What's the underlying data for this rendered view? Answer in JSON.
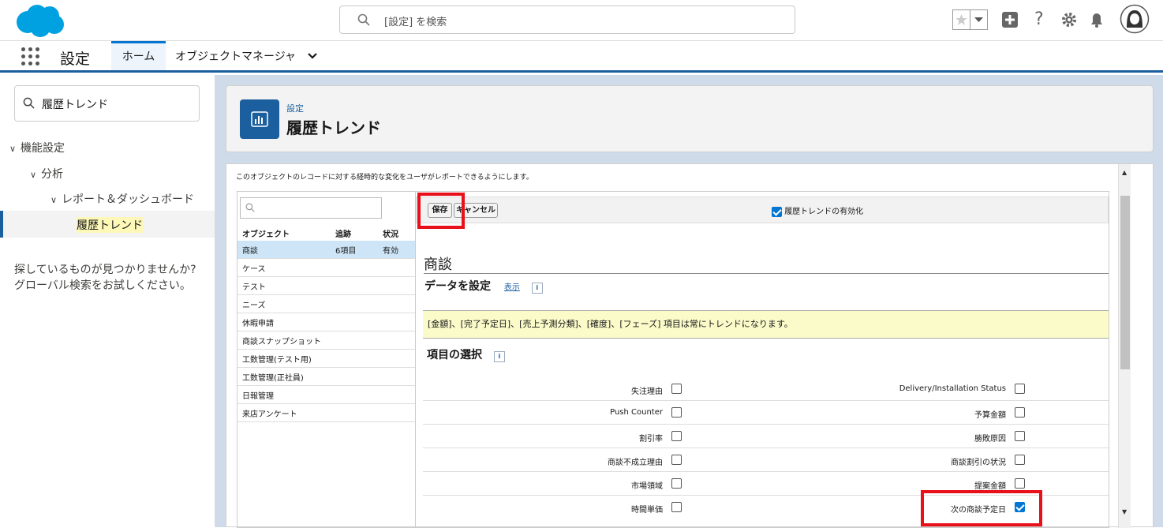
{
  "header": {
    "search_placeholder": "[設定] を検索"
  },
  "nav": {
    "app_name": "設定",
    "tab_home": "ホーム",
    "tab_object_manager": "オブジェクトマネージャ"
  },
  "sidebar": {
    "quick_find_value": "履歴トレンド",
    "tree": [
      {
        "label": "機能設定"
      },
      {
        "label": "分析"
      },
      {
        "label": "レポート＆ダッシュボード"
      },
      {
        "label": "履歴トレンド"
      }
    ],
    "not_found_line1": "探しているものが見つかりませんか?",
    "not_found_line2": "グローバル検索をお試しください。"
  },
  "page_header": {
    "breadcrumb": "設定",
    "title": "履歴トレンド"
  },
  "main": {
    "description": "このオブジェクトのレコードに対する経時的な変化をユーザがレポートできるようにします。",
    "object_table": {
      "headers": [
        "オブジェクト",
        "追跡",
        "状況"
      ],
      "rows": [
        {
          "name": "商談",
          "tracked": "6項目",
          "status": "有効",
          "selected": true
        },
        {
          "name": "ケース",
          "tracked": "",
          "status": ""
        },
        {
          "name": "テスト",
          "tracked": "",
          "status": ""
        },
        {
          "name": "ニーズ",
          "tracked": "",
          "status": ""
        },
        {
          "name": "休暇申請",
          "tracked": "",
          "status": ""
        },
        {
          "name": "商談スナップショット",
          "tracked": "",
          "status": ""
        },
        {
          "name": "工数管理(テスト用)",
          "tracked": "",
          "status": ""
        },
        {
          "name": "工数管理(正社員)",
          "tracked": "",
          "status": ""
        },
        {
          "name": "日報管理",
          "tracked": "",
          "status": ""
        },
        {
          "name": "来店アンケート",
          "tracked": "",
          "status": ""
        }
      ]
    },
    "save_label": "保存",
    "cancel_label": "キャンセル",
    "enable_label": "履歴トレンドの有効化",
    "enable_checked": true,
    "object_title": "商談",
    "data_settings_label": "データを設定",
    "show_link": "表示",
    "info_glyph": "i",
    "always_tracked_note": "[金額]、[完了予定日]、[売上予測分類]、[確度]、[フェーズ] 項目は常にトレンドになります。",
    "field_selection_label": "項目の選択",
    "fields": [
      {
        "left": "失注理由",
        "left_checked": false,
        "right": "Delivery/Installation Status",
        "right_checked": false
      },
      {
        "left": "Push Counter",
        "left_checked": false,
        "right": "予算金額",
        "right_checked": false
      },
      {
        "left": "割引率",
        "left_checked": false,
        "right": "勝敗原因",
        "right_checked": false
      },
      {
        "left": "商談不成立理由",
        "left_checked": false,
        "right": "商談割引の状況",
        "right_checked": false
      },
      {
        "left": "市場領域",
        "left_checked": false,
        "right": "提案金額",
        "right_checked": false
      },
      {
        "left": "時間単価",
        "left_checked": false,
        "right": "次の商談予定日",
        "right_checked": true
      }
    ]
  },
  "colors": {
    "brand": "#0176d3",
    "nav_border": "#1b5f9e",
    "highlight_red": "#e8101a",
    "note_bg": "#fbfbca"
  }
}
